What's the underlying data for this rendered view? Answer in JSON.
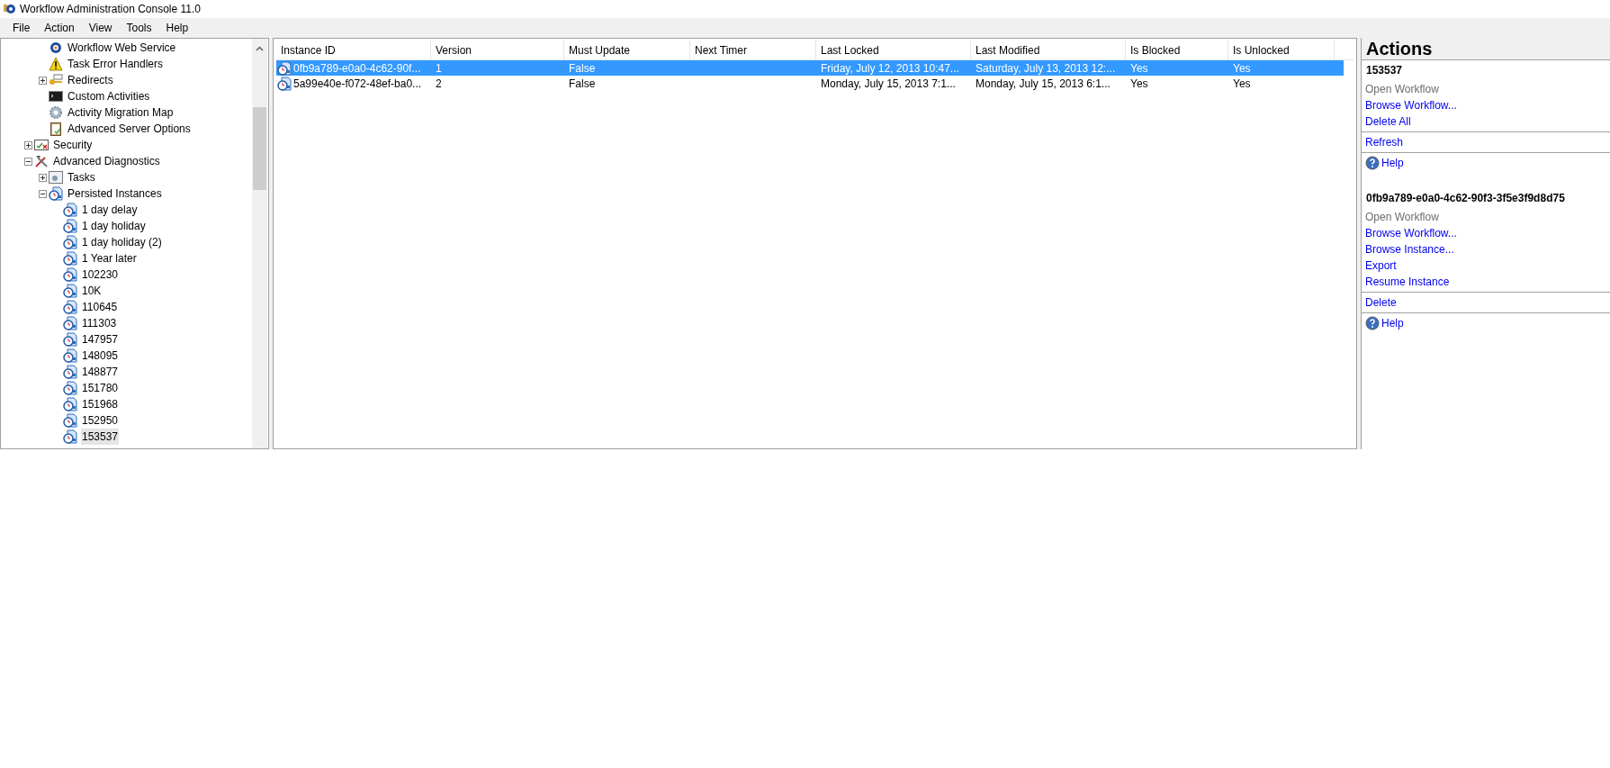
{
  "window": {
    "title": "Workflow Administration Console 11.0"
  },
  "menu": [
    "File",
    "Action",
    "View",
    "Tools",
    "Help"
  ],
  "tree": {
    "scrolled_children": [
      {
        "label": "Workflow Web Service",
        "kind": "gear",
        "selected": false
      },
      {
        "label": "Task Error Handlers",
        "kind": "warning",
        "selected": false
      },
      {
        "label": "Redirects",
        "kind": "key",
        "selected": false,
        "expanded": false
      },
      {
        "label": "Custom Activities",
        "kind": "terminal",
        "selected": false
      },
      {
        "label": "Activity Migration Map",
        "kind": "cog",
        "selected": false
      },
      {
        "label": "Advanced Server Options",
        "kind": "clipboard",
        "selected": false
      }
    ],
    "items": [
      {
        "label": "Security",
        "kind": "security",
        "selected": false,
        "expanded": false
      },
      {
        "label": "Advanced Diagnostics",
        "kind": "tools",
        "selected": false,
        "expanded": true,
        "children": [
          {
            "label": "Tasks",
            "kind": "tasks",
            "selected": false,
            "expanded": false
          },
          {
            "label": "Persisted Instances",
            "kind": "instance",
            "selected": false,
            "expanded": true,
            "children": [
              {
                "label": "1 day delay",
                "kind": "instance",
                "selected": false
              },
              {
                "label": "1 day holiday",
                "kind": "instance",
                "selected": false
              },
              {
                "label": "1 day holiday (2)",
                "kind": "instance",
                "selected": false
              },
              {
                "label": "1 Year later",
                "kind": "instance",
                "selected": false
              },
              {
                "label": "102230",
                "kind": "instance",
                "selected": false
              },
              {
                "label": "10K",
                "kind": "instance",
                "selected": false
              },
              {
                "label": "110645",
                "kind": "instance",
                "selected": false
              },
              {
                "label": "111303",
                "kind": "instance",
                "selected": false
              },
              {
                "label": "147957",
                "kind": "instance",
                "selected": false
              },
              {
                "label": "148095",
                "kind": "instance",
                "selected": false
              },
              {
                "label": "148877",
                "kind": "instance",
                "selected": false
              },
              {
                "label": "151780",
                "kind": "instance",
                "selected": false
              },
              {
                "label": "151968",
                "kind": "instance",
                "selected": false
              },
              {
                "label": "152950",
                "kind": "instance",
                "selected": false
              },
              {
                "label": "153537",
                "kind": "instance",
                "selected": true
              }
            ]
          }
        ]
      }
    ]
  },
  "table": {
    "columns": [
      "Instance ID",
      "Version",
      "Must Update",
      "Next Timer",
      "Last Locked",
      "Last Modified",
      "Is Blocked",
      "Is Unlocked"
    ],
    "rows": [
      {
        "selected": true,
        "cells": [
          "0fb9a789-e0a0-4c62-90f...",
          "1",
          "False",
          "",
          "Friday, July 12, 2013 10:47...",
          "Saturday, July 13, 2013 12:...",
          "Yes",
          "Yes"
        ]
      },
      {
        "selected": false,
        "cells": [
          "5a99e40e-f072-48ef-ba0...",
          "2",
          "False",
          "",
          "Monday, July 15, 2013 7:1...",
          "Monday, July 15, 2013 6:1...",
          "Yes",
          "Yes"
        ]
      }
    ]
  },
  "actions": {
    "title": "Actions",
    "sections": [
      {
        "title": "153537",
        "groups": [
          [
            {
              "label": "Open Workflow",
              "kind": "link",
              "disabled": true
            },
            {
              "label": "Browse Workflow...",
              "kind": "link",
              "disabled": false
            },
            {
              "label": "Delete All",
              "kind": "link",
              "disabled": false
            }
          ],
          [
            {
              "label": "Refresh",
              "kind": "link",
              "disabled": false
            }
          ],
          [
            {
              "label": "Help",
              "kind": "help",
              "disabled": false
            }
          ]
        ]
      },
      {
        "title": "0fb9a789-e0a0-4c62-90f3-3f5e3f9d8d75",
        "groups": [
          [
            {
              "label": "Open Workflow",
              "kind": "link",
              "disabled": true
            },
            {
              "label": "Browse Workflow...",
              "kind": "link",
              "disabled": false
            },
            {
              "label": "Browse Instance...",
              "kind": "link",
              "disabled": false
            },
            {
              "label": "Export",
              "kind": "link",
              "disabled": false
            },
            {
              "label": "Resume Instance",
              "kind": "link",
              "disabled": false
            }
          ],
          [
            {
              "label": "Delete",
              "kind": "link",
              "disabled": false
            }
          ],
          [
            {
              "label": "Help",
              "kind": "help",
              "disabled": false
            }
          ]
        ]
      }
    ]
  }
}
